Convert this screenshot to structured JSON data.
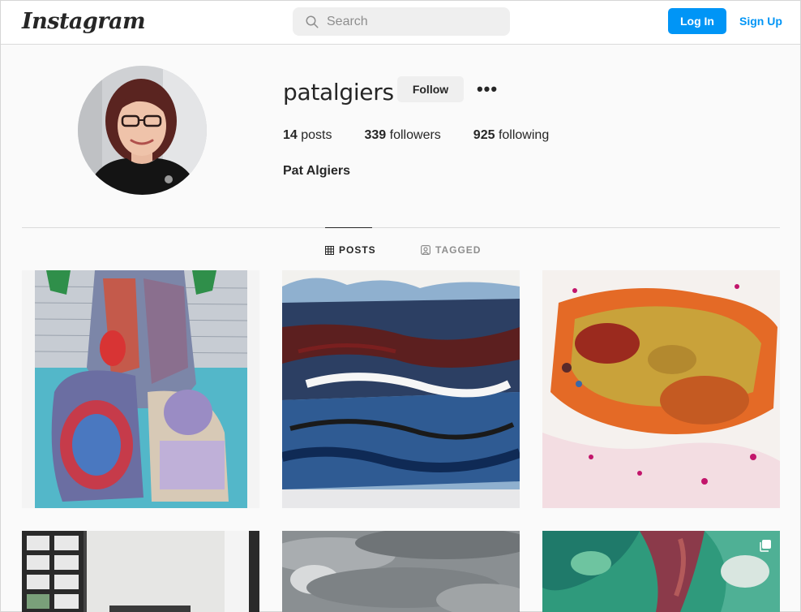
{
  "nav": {
    "logo": "Instagram",
    "search_placeholder": "Search",
    "login_label": "Log In",
    "signup_label": "Sign Up",
    "accent_color": "#0095f6"
  },
  "profile": {
    "username": "patalgiers",
    "follow_label": "Follow",
    "more_label": "•••",
    "stats": [
      {
        "count": "14",
        "label": "posts"
      },
      {
        "count": "339",
        "label": "followers"
      },
      {
        "count": "925",
        "label": "following"
      }
    ],
    "full_name": "Pat Algiers"
  },
  "tabs": [
    {
      "label": "POSTS",
      "icon": "grid-icon",
      "active": true
    },
    {
      "label": "TAGGED",
      "icon": "tagged-icon",
      "active": false
    }
  ],
  "posts": [
    {
      "icon": "artwork-figure-painting"
    },
    {
      "icon": "artwork-blue-abstract"
    },
    {
      "icon": "artwork-orange-abstract"
    },
    {
      "icon": "photo-window-room"
    },
    {
      "icon": "photo-cloudy-sky"
    },
    {
      "icon": "artwork-green-abstract",
      "multiple": true
    }
  ]
}
